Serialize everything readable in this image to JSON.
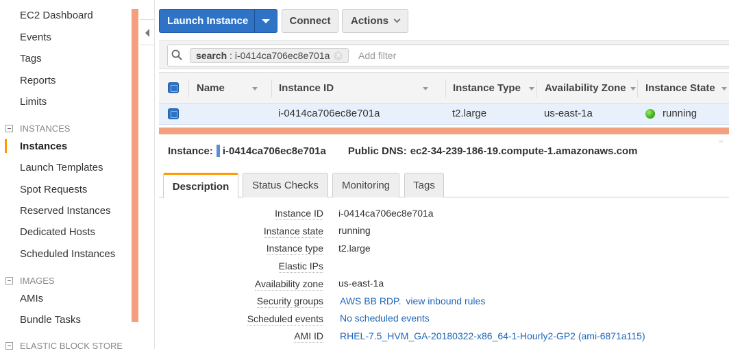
{
  "sidebar": {
    "items": [
      {
        "label": "EC2 Dashboard"
      },
      {
        "label": "Events"
      },
      {
        "label": "Tags"
      },
      {
        "label": "Reports"
      },
      {
        "label": "Limits"
      }
    ],
    "sections": [
      {
        "title": "INSTANCES",
        "items": [
          "Instances",
          "Launch Templates",
          "Spot Requests",
          "Reserved Instances",
          "Dedicated Hosts",
          "Scheduled Instances"
        ]
      },
      {
        "title": "IMAGES",
        "items": [
          "AMIs",
          "Bundle Tasks"
        ]
      },
      {
        "title": "ELASTIC BLOCK STORE",
        "items": []
      }
    ],
    "active_item": "Instances"
  },
  "toolbar": {
    "launch_label": "Launch Instance",
    "connect_label": "Connect",
    "actions_label": "Actions"
  },
  "filter": {
    "token_key": "search",
    "token_value": "i-0414ca706ec8e701a",
    "placeholder": "Add filter"
  },
  "table": {
    "columns": [
      "Name",
      "Instance ID",
      "Instance Type",
      "Availability Zone",
      "Instance State"
    ],
    "rows": [
      {
        "name": "",
        "instance_id": "i-0414ca706ec8e701a",
        "instance_type": "t2.large",
        "availability_zone": "us-east-1a",
        "instance_state": "running",
        "state_color": "#3cb317"
      }
    ]
  },
  "detail_header": {
    "instance_label": "Instance:",
    "instance_id": "i-0414ca706ec8e701a",
    "dns_label": "Public DNS:",
    "dns_value": "ec2-34-239-186-19.compute-1.amazonaws.com"
  },
  "tabs": [
    "Description",
    "Status Checks",
    "Monitoring",
    "Tags"
  ],
  "description": {
    "fields": [
      {
        "label": "Instance ID",
        "value": "i-0414ca706ec8e701a"
      },
      {
        "label": "Instance state",
        "value": "running"
      },
      {
        "label": "Instance type",
        "value": "t2.large"
      },
      {
        "label": "Elastic IPs",
        "value": ""
      },
      {
        "label": "Availability zone",
        "value": "us-east-1a"
      },
      {
        "label": "Security groups",
        "value": "AWS BB RDP.",
        "link_value": "view inbound rules"
      },
      {
        "label": "Scheduled events",
        "value": "No scheduled events"
      },
      {
        "label": "AMI ID",
        "value": "RHEL-7.5_HVM_GA-20180322-x86_64-1-Hourly2-GP2 (ami-6871a115)"
      }
    ]
  },
  "colors": {
    "primary": "#2f73c7",
    "accent_stripe": "#f4a07e",
    "active_tab": "#ff9900",
    "link": "#1f66b8"
  }
}
